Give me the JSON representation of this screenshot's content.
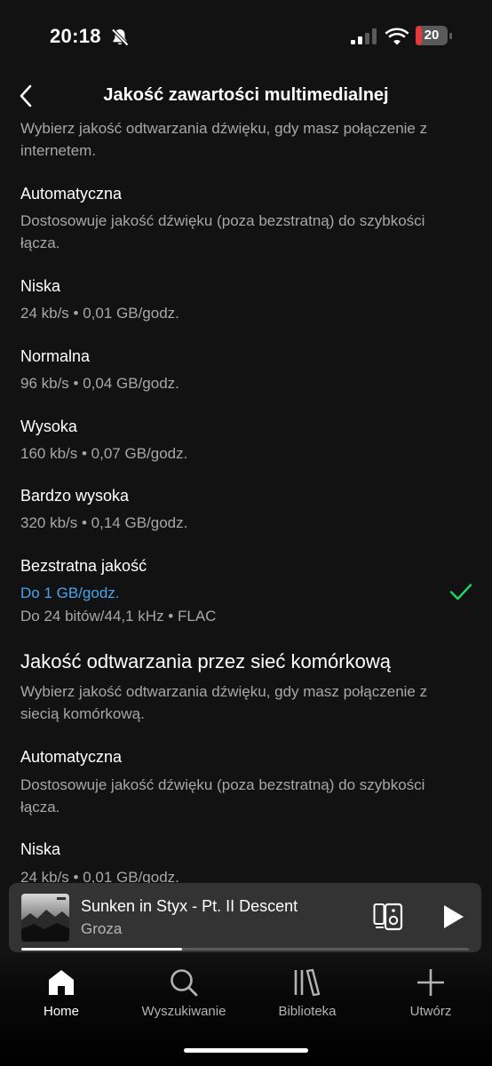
{
  "status": {
    "time": "20:18",
    "battery_level": "20",
    "battery_fraction": 0.2,
    "icons": [
      "bell-slash-icon",
      "signal-icon",
      "wifi-icon",
      "battery-icon"
    ]
  },
  "header": {
    "title": "Jakość zawartości multimedialnej",
    "back_icon": "chevron-left-icon"
  },
  "wifi_section": {
    "description": "Wybierz jakość odtwarzania dźwięku, gdy masz połączenie z internetem.",
    "options": [
      {
        "label": "Automatyczna",
        "detail": "Dostosowuje jakość dźwięku (poza bezstratną) do szybkości łącza."
      },
      {
        "label": "Niska",
        "detail": "24 kb/s • 0,01 GB/godz."
      },
      {
        "label": "Normalna",
        "detail": "96 kb/s • 0,04 GB/godz."
      },
      {
        "label": "Wysoka",
        "detail": "160 kb/s • 0,07 GB/godz."
      },
      {
        "label": "Bardzo wysoka",
        "detail": "320 kb/s • 0,14 GB/godz."
      },
      {
        "label": "Bezstratna jakość",
        "highlight": "Do 1 GB/godz.",
        "detail": "Do 24 bitów/44,1 kHz • FLAC",
        "selected": true
      }
    ]
  },
  "cellular_section": {
    "heading": "Jakość odtwarzania przez sieć komórkową",
    "description": "Wybierz jakość odtwarzania dźwięku, gdy masz połączenie z siecią komórkową.",
    "options": [
      {
        "label": "Automatyczna",
        "detail": "Dostosowuje jakość dźwięku (poza bezstratną) do szybkości łącza."
      },
      {
        "label": "Niska",
        "detail": "24 kb/s • 0,01 GB/godz."
      }
    ]
  },
  "mini_player": {
    "title": "Sunken in Styx - Pt. II Descent",
    "artist": "Groza",
    "progress": 0.36,
    "icons": [
      "connect-device-icon",
      "play-icon"
    ]
  },
  "nav": {
    "items": [
      {
        "label": "Home",
        "icon": "home-icon",
        "active": true
      },
      {
        "label": "Wyszukiwanie",
        "icon": "search-icon"
      },
      {
        "label": "Biblioteka",
        "icon": "library-icon"
      },
      {
        "label": "Utwórz",
        "icon": "plus-icon"
      }
    ]
  },
  "colors": {
    "background": "#121212",
    "accent_green": "#1ed760",
    "link_blue": "#4aa3f0",
    "battery_low": "#e5383b"
  }
}
